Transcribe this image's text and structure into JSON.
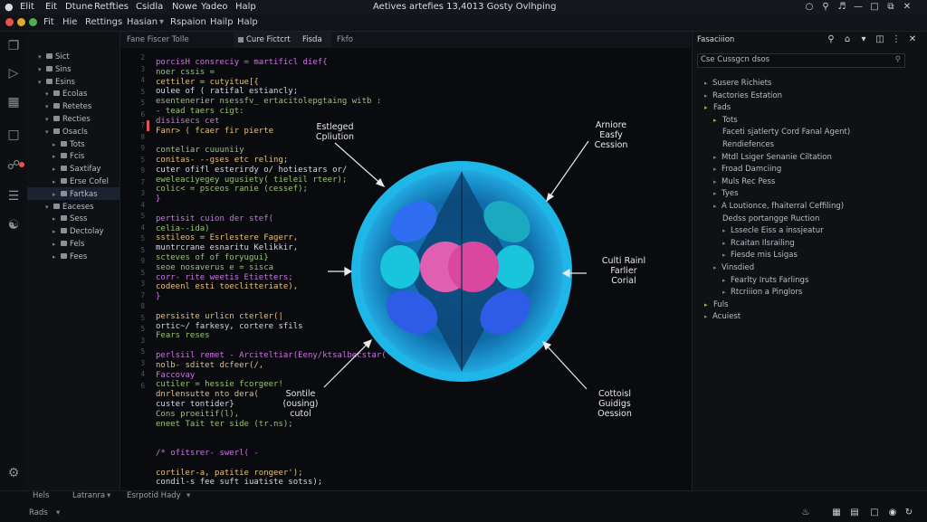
{
  "titlebar": {
    "menu": [
      "Elit",
      "Eit",
      "Dtune",
      "Retfties",
      "Csidla",
      "Nowe",
      "Yadeo",
      "Halp"
    ],
    "window_title": "Aetives artefies 13,4013 Gosty Ovlhping"
  },
  "menubar": {
    "items": [
      "Fit",
      "Hie",
      "Rettings",
      "Hasian",
      "Rspaion",
      "Hailp",
      "Halp"
    ]
  },
  "colors": {
    "close": "#e5534b",
    "minimize": "#e0a82e",
    "zoom": "#4caf50",
    "accent": "#2b7bd6",
    "nucleus": "#e05fb0"
  },
  "explorer": {
    "items": [
      {
        "label": "Sict",
        "indent": 1
      },
      {
        "label": "Sins",
        "indent": 1
      },
      {
        "label": "Esins",
        "indent": 1
      },
      {
        "label": "Ecolas",
        "indent": 2
      },
      {
        "label": "Retetes",
        "indent": 2
      },
      {
        "label": "Recties",
        "indent": 2
      },
      {
        "label": "Osacls",
        "indent": 2
      },
      {
        "label": "Tots",
        "indent": 3
      },
      {
        "label": "Fcis",
        "indent": 3
      },
      {
        "label": "Saxtifay",
        "indent": 3
      },
      {
        "label": "Erse Cofel",
        "indent": 3
      },
      {
        "label": "Fartkas",
        "indent": 3
      },
      {
        "label": "Eaceses",
        "indent": 2
      },
      {
        "label": "Sess",
        "indent": 3
      },
      {
        "label": "Dectolay",
        "indent": 3
      },
      {
        "label": "Fels",
        "indent": 3
      },
      {
        "label": "Fees",
        "indent": 3
      }
    ]
  },
  "tabs": [
    "Fane Fiscer Tolle",
    "Cure Fictcrt",
    "Fisda",
    "Fkfo"
  ],
  "editor": {
    "line_numbers": [
      "2",
      "3",
      "4",
      "5",
      "5",
      "6",
      "7",
      "8",
      "9",
      "5",
      "9",
      "7",
      "3",
      "4",
      "5",
      "4",
      "5",
      "5",
      "9",
      "5",
      "3",
      "7",
      "8",
      "5",
      "5",
      "3",
      "5",
      "3",
      "4",
      "6"
    ],
    "code": [
      "porcisH consreciy = martificl dief{",
      "  noer cssis =",
      "  cettiler = cutyitue[{",
      "    oulee of ( ratifal estiancly;",
      "    esentenerier nsessfv_ ertacitolepgtaing witb :",
      "    - tead taers cigt:",
      "      disiisecs cet",
      "      Fanr> ( fcaer fir pierte",
      "",
      "conteliar cuuuniiy",
      "  conitas- --gses   etc reling;",
      "    cuter ofifl esterirdy o/ hotiestars or/",
      "    eweleaciyegey ugusiety( tieleil rteer);",
      "    colic< = psceos ranie (cessef);",
      "}",
      "",
      "pertisit cuion der stef(",
      "  celia--ida)",
      "  sstileos = Esrlestere Fagerr,",
      "  muntrcrane esnaritu Kelikkir,",
      "  scteves of of foryugui}",
      "  seoe nosaverus e = sisca",
      "    corr- rite weetis  Etietters;",
      "    codeenl esti toeclitteriate),",
      "}",
      "",
      "persisite urlicn cterler(|",
      "  ortic~/ farkesy, cortere sfils",
      "  Fears reses",
      "",
      "perlsiil remet - Arciteltiar(Eeny/ktsalbecstar(",
      "  nolb- sditet dcfeer(/,",
      "  Faccovay",
      "    cutiler = hessie fcorgeer!",
      "      dnrlensutte nto dera(",
      "      custer  tontider}",
      "      Cons proeitif(l),",
      "      eneet Tait ter side (tr.ns);",
      "",
      "",
      "/* ofitsrer- swerl(  -",
      "",
      "  cortiler-a, patitie rongeer');",
      "  condil-s fee suft iuatiste sotss);"
    ]
  },
  "diagram": {
    "labels": {
      "top_left": [
        "Estleged",
        "Cpliution"
      ],
      "top_right": [
        "Arniore",
        "Easfy",
        "Cession"
      ],
      "mid_right": [
        "Culti Rainl",
        "Farlier",
        "Corial"
      ],
      "bottom_left": [
        "Sontile",
        "(ousing)",
        "cutol"
      ],
      "bottom_right": [
        "Cottoisl",
        "Guidigs",
        "Oession"
      ]
    }
  },
  "rpanel": {
    "title": "Fasaciiion",
    "search_value": "Cse Cussgcn dsos",
    "items": [
      {
        "label": "Susere Richiets",
        "indent": 1,
        "twisty": "grey"
      },
      {
        "label": "Ractories Estation",
        "indent": 1,
        "twisty": "grey"
      },
      {
        "label": "Fads",
        "indent": 1,
        "twisty": "green"
      },
      {
        "label": "Tots",
        "indent": 2,
        "twisty": "green"
      },
      {
        "label": "Faceti sjatlerty Cord Fanal Agent)",
        "indent": 3,
        "twisty": ""
      },
      {
        "label": "Rendiefences",
        "indent": 3,
        "twisty": ""
      },
      {
        "label": "Mtdl Lsiger Senanie Ciltation",
        "indent": 2,
        "twisty": "grey"
      },
      {
        "label": "Froad Damciing",
        "indent": 2,
        "twisty": "grey"
      },
      {
        "label": "Muls Rec Pess",
        "indent": 2,
        "twisty": "grey"
      },
      {
        "label": "Tyes",
        "indent": 2,
        "twisty": "grey"
      },
      {
        "label": "A Loutionce, fhaiterral Ceffiling)",
        "indent": 2,
        "twisty": "grey"
      },
      {
        "label": "Dedss portangge Ruction",
        "indent": 3,
        "twisty": ""
      },
      {
        "label": "Lssecle Eiss a inssjeatur",
        "indent": 3,
        "twisty": "grey"
      },
      {
        "label": "Rcaitan Ilsrailing",
        "indent": 3,
        "twisty": "grey"
      },
      {
        "label": "Fiesde mis Lsigas",
        "indent": 3,
        "twisty": "grey"
      },
      {
        "label": "Vinsdied",
        "indent": 2,
        "twisty": "grey"
      },
      {
        "label": "Fearlty Iruts Farlings",
        "indent": 3,
        "twisty": "grey"
      },
      {
        "label": "Rtcriiion a Pinglors",
        "indent": 3,
        "twisty": "grey"
      },
      {
        "label": "Fuls",
        "indent": 1,
        "twisty": "green"
      },
      {
        "label": "Acuiest",
        "indent": 1,
        "twisty": "grey"
      }
    ]
  },
  "status": {
    "row1": [
      "Hels",
      "Latranra",
      "Esrpotid Hady"
    ],
    "row2": "Rads"
  }
}
